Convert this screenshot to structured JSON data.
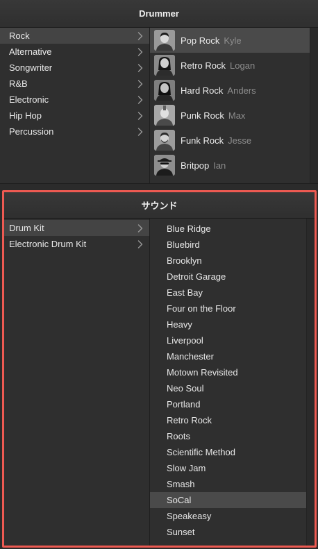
{
  "drummer_panel": {
    "title": "Drummer",
    "genres": [
      {
        "label": "Rock",
        "selected": true
      },
      {
        "label": "Alternative",
        "selected": false
      },
      {
        "label": "Songwriter",
        "selected": false
      },
      {
        "label": "R&B",
        "selected": false
      },
      {
        "label": "Electronic",
        "selected": false
      },
      {
        "label": "Hip Hop",
        "selected": false
      },
      {
        "label": "Percussion",
        "selected": false
      }
    ],
    "drummers": [
      {
        "style": "Pop Rock",
        "name": "Kyle",
        "selected": true,
        "avatar": "drummer-avatar-kyle"
      },
      {
        "style": "Retro Rock",
        "name": "Logan",
        "selected": false,
        "avatar": "drummer-avatar-logan"
      },
      {
        "style": "Hard Rock",
        "name": "Anders",
        "selected": false,
        "avatar": "drummer-avatar-anders"
      },
      {
        "style": "Punk Rock",
        "name": "Max",
        "selected": false,
        "avatar": "drummer-avatar-max"
      },
      {
        "style": "Funk Rock",
        "name": "Jesse",
        "selected": false,
        "avatar": "drummer-avatar-jesse"
      },
      {
        "style": "Britpop",
        "name": "Ian",
        "selected": false,
        "avatar": "drummer-avatar-ian"
      }
    ]
  },
  "sound_panel": {
    "title": "サウンド",
    "highlight_color": "#ee5a52",
    "kits": [
      {
        "label": "Drum Kit",
        "selected": true
      },
      {
        "label": "Electronic Drum Kit",
        "selected": false
      }
    ],
    "sounds": [
      {
        "label": "Blue Ridge",
        "selected": false
      },
      {
        "label": "Bluebird",
        "selected": false
      },
      {
        "label": "Brooklyn",
        "selected": false
      },
      {
        "label": "Detroit Garage",
        "selected": false
      },
      {
        "label": "East Bay",
        "selected": false
      },
      {
        "label": "Four on the Floor",
        "selected": false
      },
      {
        "label": "Heavy",
        "selected": false
      },
      {
        "label": "Liverpool",
        "selected": false
      },
      {
        "label": "Manchester",
        "selected": false
      },
      {
        "label": "Motown Revisited",
        "selected": false
      },
      {
        "label": "Neo Soul",
        "selected": false
      },
      {
        "label": "Portland",
        "selected": false
      },
      {
        "label": "Retro Rock",
        "selected": false
      },
      {
        "label": "Roots",
        "selected": false
      },
      {
        "label": "Scientific Method",
        "selected": false
      },
      {
        "label": "Slow Jam",
        "selected": false
      },
      {
        "label": "Smash",
        "selected": false
      },
      {
        "label": "SoCal",
        "selected": true
      },
      {
        "label": "Speakeasy",
        "selected": false
      },
      {
        "label": "Sunset",
        "selected": false
      }
    ]
  },
  "colors": {
    "background": "#2b2b2b",
    "panel": "#323232",
    "selected_row": "#444444",
    "text": "#e8e8e8",
    "secondary_text": "#8e8e8e"
  }
}
